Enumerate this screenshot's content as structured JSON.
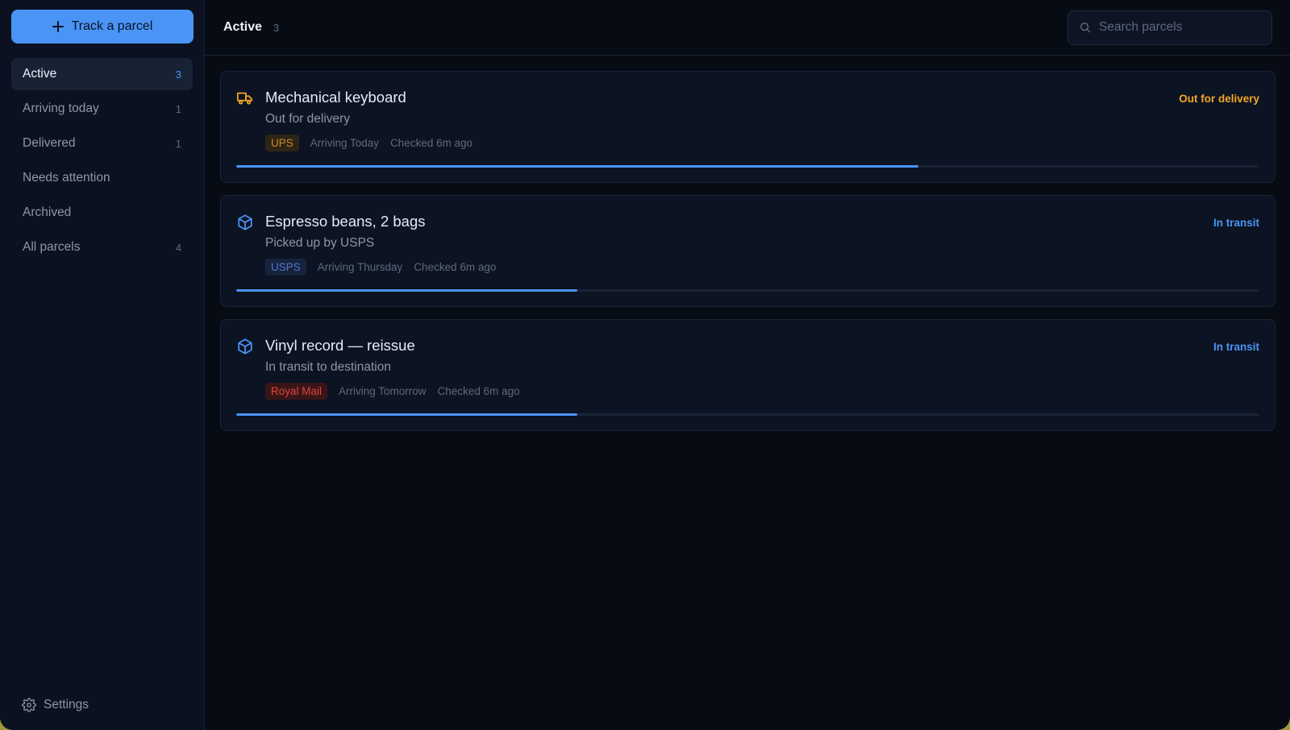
{
  "sidebar": {
    "track_button": {
      "label": "Track a parcel"
    },
    "items": [
      {
        "label": "Active",
        "count": "3",
        "active": true
      },
      {
        "label": "Arriving today",
        "count": "1"
      },
      {
        "label": "Delivered",
        "count": "1"
      },
      {
        "label": "Needs attention",
        "count": ""
      },
      {
        "label": "Archived",
        "count": ""
      },
      {
        "label": "All parcels",
        "count": "4"
      }
    ],
    "settings_label": "Settings"
  },
  "header": {
    "title": "Active",
    "count": "3",
    "search": {
      "placeholder": "Search parcels",
      "value": ""
    }
  },
  "parcels": [
    {
      "icon": "truck-icon",
      "name": "Mechanical keyboard",
      "sub": "Out for delivery",
      "carrier": "UPS",
      "carrier_fg": "#c98a2b",
      "carrier_bg": "#2e2416",
      "arriving": "Arriving Today",
      "checked": "Checked 6m ago",
      "status": "Out for delivery",
      "status_color": "#f5a524",
      "icon_color": "#f5a524",
      "progress": 0.667
    },
    {
      "icon": "package-icon",
      "name": "Espresso beans, 2 bags",
      "sub": "Picked up by USPS",
      "carrier": "USPS",
      "carrier_fg": "#4d79c9",
      "carrier_bg": "#17223d",
      "arriving": "Arriving Thursday",
      "checked": "Checked 6m ago",
      "status": "In transit",
      "status_color": "#4a94f5",
      "icon_color": "#4a94f5",
      "progress": 0.333
    },
    {
      "icon": "package-icon",
      "name": "Vinyl record — reissue",
      "sub": "In transit to destination",
      "carrier": "Royal Mail",
      "carrier_fg": "#e0443e",
      "carrier_bg": "#3a1518",
      "arriving": "Arriving Tomorrow",
      "checked": "Checked 6m ago",
      "status": "In transit",
      "status_color": "#4a94f5",
      "icon_color": "#4a94f5",
      "progress": 0.333
    }
  ]
}
